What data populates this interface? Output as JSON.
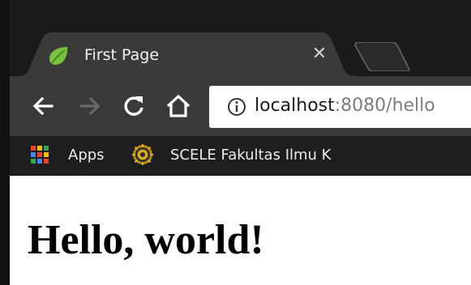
{
  "tab": {
    "title": "First Page",
    "close_glyph": "✕",
    "favicon": "spring-leaf-icon"
  },
  "toolbar": {
    "back_icon": "back-arrow-icon",
    "forward_icon": "forward-arrow-icon",
    "reload_icon": "reload-icon",
    "home_icon": "home-icon"
  },
  "omnibox": {
    "host": "localhost",
    "rest": ":8080/hello",
    "security_icon": "info-icon"
  },
  "bookmarks": {
    "items": [
      {
        "label": "Apps",
        "icon": "apps-grid-icon"
      },
      {
        "label": "SCELE Fakultas Ilmu K",
        "icon": "university-seal-icon"
      }
    ]
  },
  "page": {
    "heading": "Hello, world!"
  },
  "colors": {
    "tab_active": "#3a3a3a",
    "tabstrip": "#1a1a1a",
    "bookmarks_bar": "#1e1e1e",
    "leaf_green": "#7cc242"
  }
}
